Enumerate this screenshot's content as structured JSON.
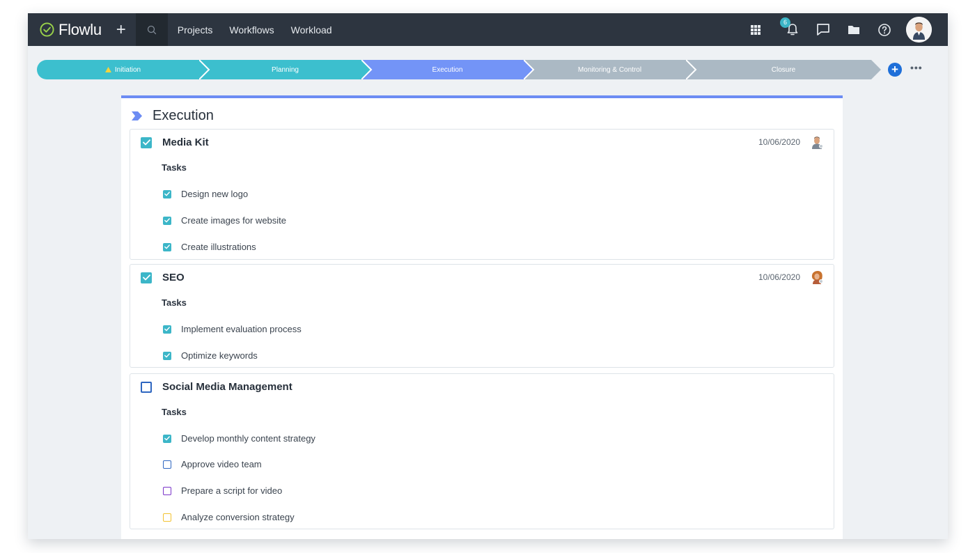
{
  "app": {
    "name": "Flowlu",
    "nav": [
      "Projects",
      "Workflows",
      "Workload"
    ],
    "notifications_count": "6"
  },
  "pipeline": {
    "stages": [
      {
        "label": "Initiation",
        "color": "#3cbfce",
        "warning": true
      },
      {
        "label": "Planning",
        "color": "#3cbfce",
        "warning": false
      },
      {
        "label": "Execution",
        "color": "#7394f7",
        "warning": false
      },
      {
        "label": "Monitoring & Control",
        "color": "#abb9c4",
        "warning": false
      },
      {
        "label": "Closure",
        "color": "#abb9c4",
        "warning": false
      }
    ],
    "add_symbol": "+",
    "more_symbol": "•••"
  },
  "section": {
    "title": "Execution",
    "accent_color": "#6c8cf3"
  },
  "cards": [
    {
      "title": "Media Kit",
      "done": true,
      "date": "10/06/2020",
      "tasks_label": "Tasks",
      "tasks": [
        {
          "text": "Design new logo",
          "done": true
        },
        {
          "text": "Create images for website",
          "done": true
        },
        {
          "text": "Create illustrations",
          "done": true
        }
      ]
    },
    {
      "title": "SEO",
      "done": true,
      "date": "10/06/2020",
      "tasks_label": "Tasks",
      "tasks": [
        {
          "text": "Implement evaluation process",
          "done": true
        },
        {
          "text": "Optimize keywords",
          "done": true
        }
      ]
    },
    {
      "title": "Social Media Management",
      "done": false,
      "date": "",
      "tasks_label": "Tasks",
      "tasks": [
        {
          "text": "Develop monthly content strategy",
          "done": true
        },
        {
          "text": "Approve video team",
          "done": false,
          "color": "#2e66c0"
        },
        {
          "text": "Prepare a script for video",
          "done": false,
          "color": "#7a35c9"
        },
        {
          "text": "Analyze conversion strategy",
          "done": false,
          "color": "#f2c230"
        }
      ]
    }
  ]
}
